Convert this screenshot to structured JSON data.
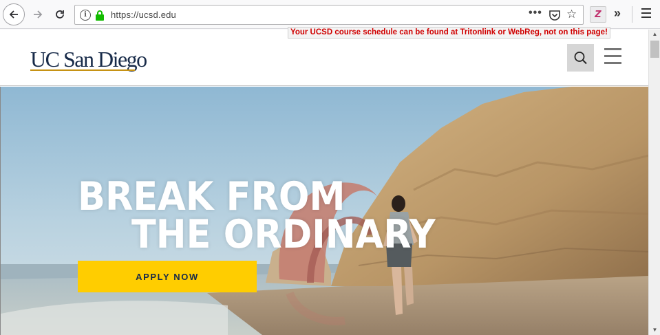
{
  "browser": {
    "url": "https://ucsd.edu",
    "url_info_glyph": "i",
    "ext_glyph": "Z",
    "tooltip": "Your UCSD course schedule can be found at Tritonlink or WebReg, not on this page!",
    "icons": [
      "back-arrow-icon",
      "forward-arrow-icon",
      "reload-icon",
      "info-icon",
      "lock-icon",
      "page-actions-icon",
      "pocket-icon",
      "bookmark-star-icon",
      "extension-icon",
      "overflow-chevron-icon",
      "hamburger-menu-icon"
    ]
  },
  "site": {
    "logo_text": "UC San Diego",
    "hero_line1": "BREAK FROM",
    "hero_line2": "THE ORDINARY",
    "apply_label": "APPLY NOW",
    "colors": {
      "navy": "#182b49",
      "gold": "#c69214",
      "yellow": "#ffcd00"
    }
  }
}
